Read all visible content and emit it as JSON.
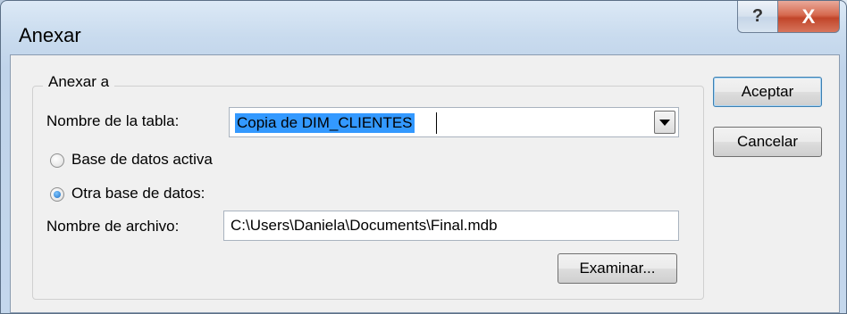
{
  "window": {
    "title": "Anexar",
    "help_glyph": "?",
    "close_glyph": "X"
  },
  "group": {
    "title": "Anexar a"
  },
  "table_name": {
    "label": "Nombre de la tabla:",
    "value": "Copia de DIM_CLIENTES"
  },
  "options": {
    "active_db_label": "Base de datos activa",
    "other_db_label": "Otra base de datos:",
    "selected": "other_db"
  },
  "file_name": {
    "label": "Nombre de archivo:",
    "value": "C:\\Users\\Daniela\\Documents\\Final.mdb"
  },
  "buttons": {
    "ok_label": "Aceptar",
    "cancel_label": "Cancelar",
    "browse_label": "Examinar..."
  },
  "colors": {
    "selection": "#3399ff",
    "close_button": "#c1452a"
  }
}
